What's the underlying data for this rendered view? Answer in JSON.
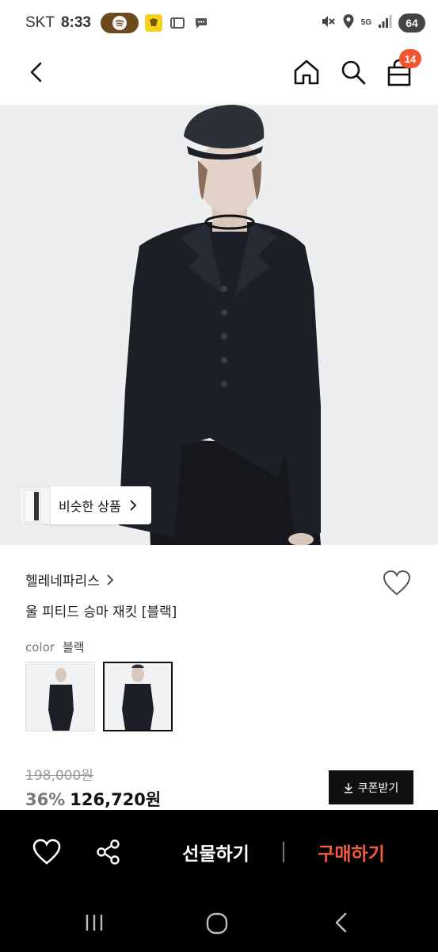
{
  "status_bar": {
    "carrier": "SKT",
    "time": "8:33",
    "network_badge": "5G",
    "battery": "64",
    "icons": [
      "spotify-icon",
      "notification-app-icon",
      "card-icon",
      "message-icon",
      "mute-icon",
      "location-icon",
      "signal-icon"
    ]
  },
  "header": {
    "icons": [
      "back-icon",
      "home-icon",
      "search-icon",
      "cart-icon"
    ],
    "cart_count": "14",
    "accent_color": "#f2542d"
  },
  "hero": {
    "similar_button_label": "비슷한 상품"
  },
  "product": {
    "brand": "헬레네파리스",
    "title": "울 피티드 승마 재킷 [블랙]",
    "color_label": "color",
    "color_value": "블랙",
    "original_price": "198,000원",
    "discount": "36%",
    "sale_price": "126,720원",
    "coupon_label": "쿠폰받기"
  },
  "buy_bar": {
    "gift_label": "선물하기",
    "buy_label": "구매하기",
    "buy_color": "#f25a3c"
  },
  "system_nav": {
    "icons": [
      "recent-apps-icon",
      "home-circle-icon",
      "back-chevron-icon"
    ]
  }
}
